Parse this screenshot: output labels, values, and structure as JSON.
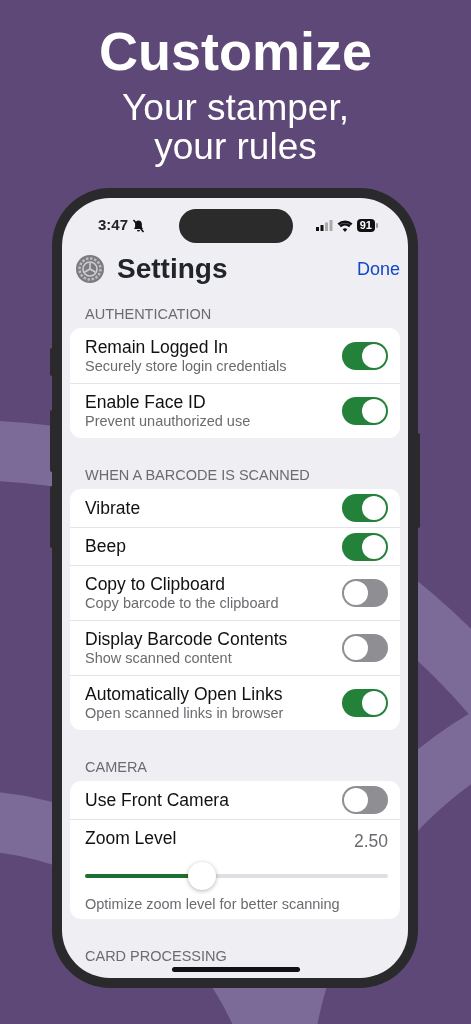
{
  "headline": "Customize",
  "subheadline": [
    "Your stamper,",
    "your rules"
  ],
  "status_bar": {
    "time": "3:47",
    "silenced": true,
    "battery": "91"
  },
  "nav": {
    "title": "Settings",
    "action": "Done"
  },
  "sections": [
    {
      "header": "AUTHENTICATION",
      "rows": [
        {
          "kind": "toggle",
          "label": "Remain Logged In",
          "subtitle": "Securely store login credentials",
          "on": true
        },
        {
          "kind": "toggle",
          "label": "Enable Face ID",
          "subtitle": "Prevent unauthorized use",
          "on": true
        }
      ]
    },
    {
      "header": "WHEN A BARCODE IS SCANNED",
      "rows": [
        {
          "kind": "toggle",
          "label": "Vibrate",
          "on": true
        },
        {
          "kind": "toggle",
          "label": "Beep",
          "on": true
        },
        {
          "kind": "toggle",
          "label": "Copy to Clipboard",
          "subtitle": "Copy barcode to the clipboard",
          "on": false
        },
        {
          "kind": "toggle",
          "label": "Display Barcode Contents",
          "subtitle": "Show scanned content",
          "on": false
        },
        {
          "kind": "toggle",
          "label": "Automatically Open Links",
          "subtitle": "Open scanned links in browser",
          "on": true
        }
      ]
    },
    {
      "header": "CAMERA",
      "rows": [
        {
          "kind": "toggle",
          "label": "Use Front Camera",
          "on": false
        },
        {
          "kind": "slider",
          "label": "Zoom Level",
          "reading": "2.50",
          "level": 0.385,
          "footnote": "Optimize zoom level for better scanning"
        }
      ]
    },
    {
      "header": "CARD PROCESSING"
    }
  ]
}
